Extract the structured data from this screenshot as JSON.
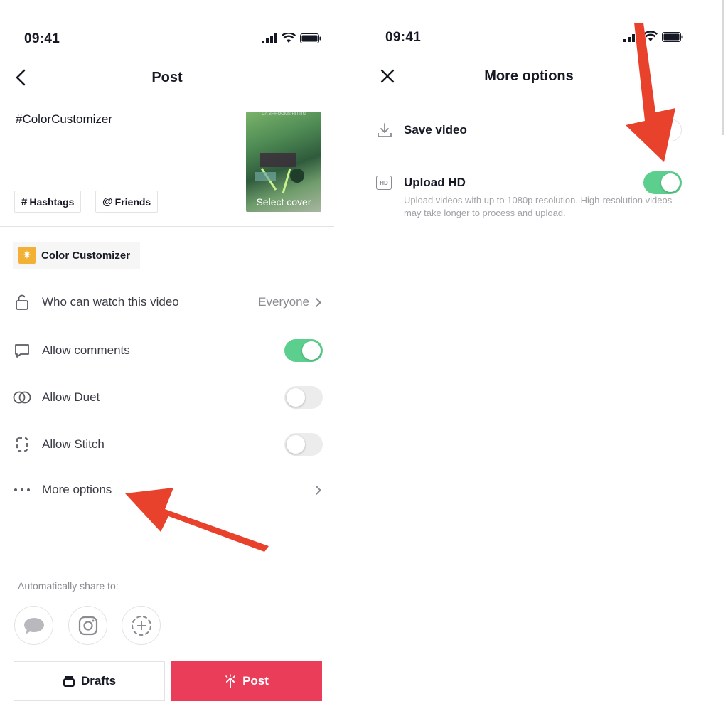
{
  "left": {
    "status_time": "09:41",
    "nav_title": "Post",
    "caption": "#ColorCustomizer",
    "chips": {
      "hashtags": "Hashtags",
      "friends": "Friends"
    },
    "cover_label": "Select cover",
    "effect_label": "Color Customizer",
    "rows": {
      "who_can_watch": {
        "label": "Who can watch this video",
        "value": "Everyone"
      },
      "allow_comments": {
        "label": "Allow comments",
        "on": true
      },
      "allow_duet": {
        "label": "Allow Duet",
        "on": false
      },
      "allow_stitch": {
        "label": "Allow Stitch",
        "on": false
      },
      "more_options": {
        "label": "More options"
      }
    },
    "share_label": "Automatically share to:",
    "drafts_label": "Drafts",
    "post_label": "Post"
  },
  "right": {
    "status_time": "09:41",
    "nav_title": "More options",
    "save_video_label": "Save video",
    "upload_hd_label": "Upload HD",
    "upload_hd_description": "Upload videos with up to 1080p resolution. High-resolution videos may take longer to process and upload.",
    "upload_hd_on": true
  },
  "colors": {
    "toggle_on": "#5ccf8e",
    "post_button": "#ea3d5a",
    "annotation_arrow": "#e8412c"
  }
}
